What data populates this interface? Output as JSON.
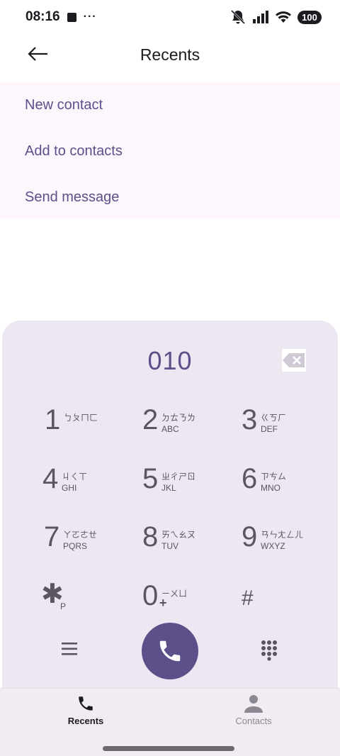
{
  "status_bar": {
    "time": "08:16",
    "dots": "···",
    "battery": "100",
    "icons": [
      "stop-square-icon",
      "bell-muted-icon",
      "cell-signal-icon",
      "wifi-icon",
      "battery-icon"
    ]
  },
  "app_bar": {
    "title": "Recents",
    "back_icon": "arrow-left-icon"
  },
  "menu": {
    "items": [
      {
        "label": "New contact"
      },
      {
        "label": "Add to contacts"
      },
      {
        "label": "Send message"
      }
    ]
  },
  "dialer": {
    "number": "010",
    "backspace_icon": "backspace-icon",
    "keys": [
      {
        "digit": "1",
        "bopo": "ㄅㄆㄇㄈ",
        "latin": ""
      },
      {
        "digit": "2",
        "bopo": "ㄉㄊㄋㄌ",
        "latin": "ABC"
      },
      {
        "digit": "3",
        "bopo": "ㄍㄎㄏ",
        "latin": "DEF"
      },
      {
        "digit": "4",
        "bopo": "ㄐㄑㄒ",
        "latin": "GHI"
      },
      {
        "digit": "5",
        "bopo": "ㄓㄔㄕㄖ",
        "latin": "JKL"
      },
      {
        "digit": "6",
        "bopo": "ㄗㄘㄙ",
        "latin": "MNO"
      },
      {
        "digit": "7",
        "bopo": "ㄚㄛㄜㄝ",
        "latin": "PQRS"
      },
      {
        "digit": "8",
        "bopo": "ㄞㄟㄠㄡ",
        "latin": "TUV"
      },
      {
        "digit": "9",
        "bopo": "ㄢㄣㄤㄥㄦ",
        "latin": "WXYZ"
      }
    ],
    "star_key": {
      "symbol": "✱",
      "sub": "P"
    },
    "zero_key": {
      "digit": "0",
      "bopo": "ㄧㄨㄩ",
      "sub": "+"
    },
    "hash_key": {
      "symbol": "#"
    },
    "accent_color": "#5c4f8a"
  },
  "bottom_nav": {
    "items": [
      {
        "label": "Recents",
        "icon": "phone-icon",
        "active": true
      },
      {
        "label": "Contacts",
        "icon": "person-icon",
        "active": false
      }
    ]
  }
}
